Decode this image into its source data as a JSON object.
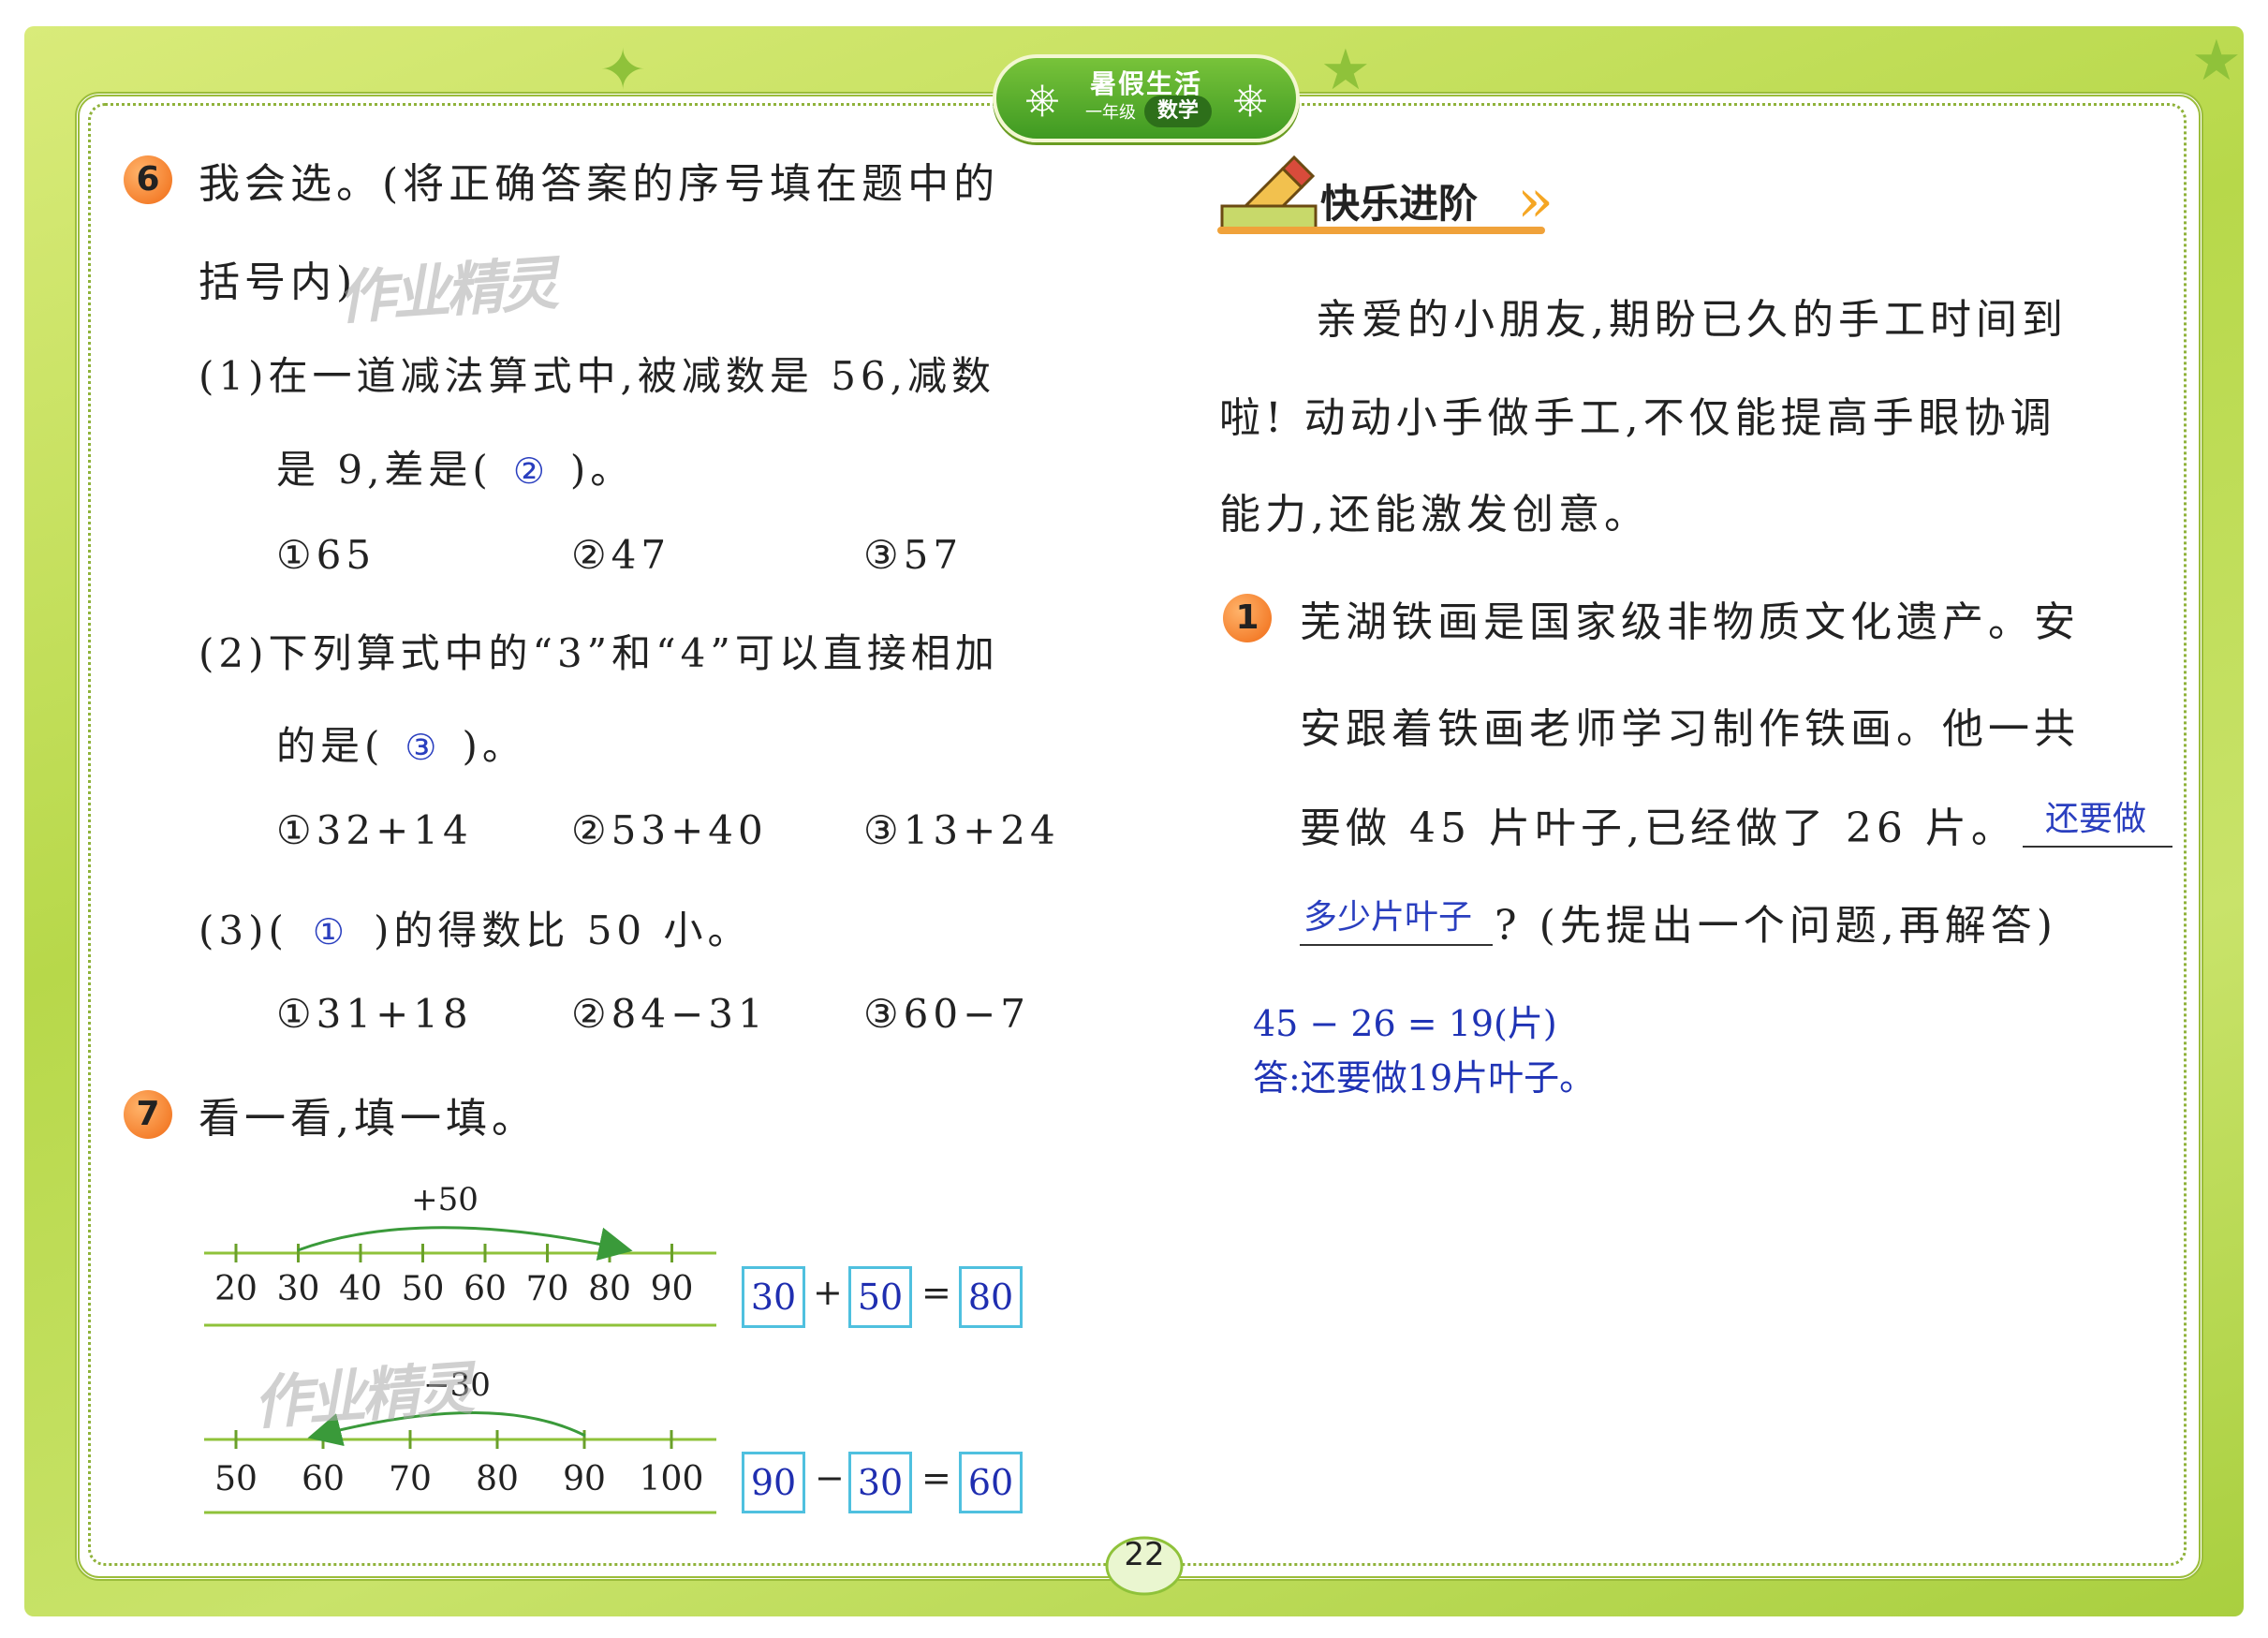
{
  "header": {
    "book_title": "暑假生活",
    "grade": "一年级",
    "subject": "数学"
  },
  "q6": {
    "number": "6",
    "instruction_line1": "我会选。(将正确答案的序号填在题中的",
    "instruction_line2": "括号内)",
    "p1": {
      "line1": "(1)在一道减法算式中,被减数是 56,减数",
      "line2_prefix": "是 9,差是(",
      "answer": "②",
      "line2_suffix": ")。",
      "options": [
        "①65",
        "②47",
        "③57"
      ]
    },
    "p2": {
      "line1": "(2)下列算式中的“3”和“4”可以直接相加",
      "line2_prefix": "的是(",
      "answer": "③",
      "line2_suffix": ")。",
      "options": [
        "①32+14",
        "②53+40",
        "③13+24"
      ]
    },
    "p3": {
      "line1_prefix": "(3)(",
      "answer": "①",
      "line1_suffix": ")的得数比 50 小。",
      "options": [
        "①31+18",
        "②84−31",
        "③60−7"
      ]
    }
  },
  "q7": {
    "number": "7",
    "instruction": "看一看,填一填。",
    "line1": {
      "jump_label": "+50",
      "ticks": [
        "20",
        "30",
        "40",
        "50",
        "60",
        "70",
        "80",
        "90"
      ],
      "eq": {
        "a": "30",
        "op": "+",
        "b": "50",
        "eq": "=",
        "c": "80"
      }
    },
    "line2": {
      "jump_label": "−30",
      "ticks": [
        "50",
        "60",
        "70",
        "80",
        "90",
        "100"
      ],
      "eq": {
        "a": "90",
        "op": "−",
        "b": "30",
        "eq": "=",
        "c": "60"
      }
    }
  },
  "section": {
    "title": "快乐进阶"
  },
  "intro": {
    "line1": "亲爱的小朋友,期盼已久的手工时间到",
    "line2": "啦! 动动小手做手工,不仅能提高手眼协调",
    "line3": "能力,还能激发创意。"
  },
  "q1": {
    "number": "1",
    "line1": "芜湖铁画是国家级非物质文化遗产。安",
    "line2": "安跟着铁画老师学习制作铁画。他一共",
    "line3": "要做 45 片叶子,已经做了 26 片。",
    "blank1": "还要做",
    "blank2": "多少片叶子",
    "line4_suffix": "? (先提出一个问题,再解答)",
    "solution": "45 − 26 = 19(片)",
    "answer": "答:还要做19片叶子。"
  },
  "watermark": "作业精灵",
  "page_number": "22",
  "colors": {
    "frame": "#b7d84a",
    "badge": "#4fa52a",
    "number_badge": "#f06a14",
    "handwriting": "#2a3fbf",
    "answer_box": "#4fc0df"
  }
}
